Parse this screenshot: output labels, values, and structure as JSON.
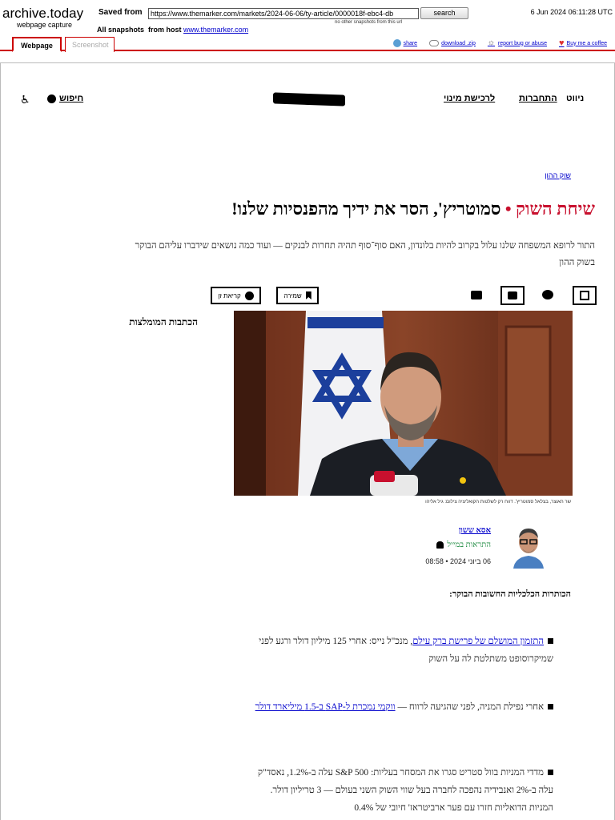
{
  "archive": {
    "logo": "archive.today",
    "logo_sub": "webpage capture",
    "saved_from_label": "Saved from",
    "url": "https://www.themarker.com/markets/2024-06-06/ty-article/0000018f-ebc4-db",
    "search_label": "search",
    "no_other_snapshots": "no other snapshots from this url",
    "date": "6 Jun 2024 06:11:28 UTC",
    "all_snapshots_label": "All snapshots",
    "from_host_label": "from host",
    "host": "www.themarker.com",
    "tabs": [
      {
        "label": "Webpage",
        "active": true
      },
      {
        "label": "Screenshot",
        "active": false
      }
    ],
    "links": [
      {
        "label": "share",
        "icon": "share-icon"
      },
      {
        "label": "download .zip",
        "icon": "cloud-download-icon"
      },
      {
        "label": "report bug or abuse",
        "icon": "bug-icon"
      },
      {
        "label": "Buy me a coffee",
        "icon": "heart-icon"
      }
    ]
  },
  "site": {
    "nav": {
      "search": "חיפוש",
      "subscribe": "לרכישת מינוי",
      "login": "התחברות",
      "navigation": "ניווט"
    },
    "section": "שוק ההון",
    "headline": {
      "kicker": "שיחת השוק",
      "separator": "•",
      "title": "סמוטריץ', הסר את ידיך מהפנסיות שלנו!"
    },
    "subhead": "התור לרופא המשפחה שלנו עלול בקרוב להיות בלונדון, האם סוף־סוף תהיה תחרות לבנקים — ועוד כמה נושאים שידברו עליהם הבוקר בשוק ההון",
    "tools": {
      "save": "שמירה",
      "zen": "קריאת זן"
    },
    "image_caption": "שר האוצר, בצלאל סמוטריץ'. דווח רק לשלטות הקואליציה   צילום: גיל אליהו",
    "recommended": "הכתבות המומלצות",
    "author": {
      "name": "אסא ששון",
      "alerts": "התראות במייל",
      "date": "06 ביוני 2024 • 08:58"
    },
    "body_heading": "הכותרות הכלכליות החשובות הבוקר:",
    "bullets": [
      {
        "link": "התזמון המושלם של פרישת ברק עילם",
        "text": ", מנכ\"ל נייס: אחרי 125 מיליון דולר ורגע לפני שמיקרוסופט משתלטת לה על השוק"
      },
      {
        "text": "אחרי נפילת המניה, לפני שהגיעה לרווח — ",
        "link": "ווקמי נמכרת ל-SAP ב-1.5 מיליארד דולר"
      },
      {
        "text": "מדדי המניות בוול סטריט סגרו את המסחר בעליות: S&P 500 עלה ב-1.2%, נאסד\"ק עלה ב-2% ואנבידיה נהפכה לחברה בעל שווי השוק השני בעולם — 3 טריליון דולר. המניות הדואליות חזרו עם פער ארביטראז' חיובי של 0.4%"
      }
    ]
  }
}
